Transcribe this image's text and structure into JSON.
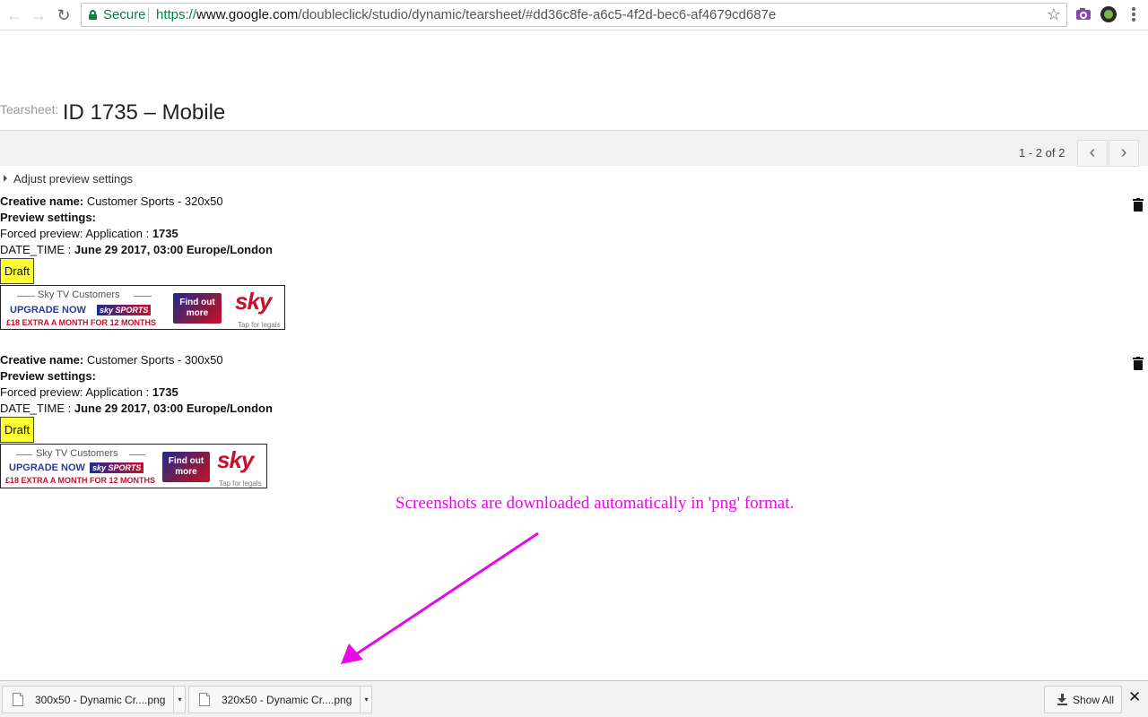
{
  "browser": {
    "secure_label": "Secure",
    "url_scheme": "https://",
    "url_host": "www.google.com",
    "url_path": "/doubleclick/studio/dynamic/tearsheet/#dd36c8fe-a6c5-4f2d-bec6-af4679cd687e",
    "back_icon": "←",
    "forward_icon": "→",
    "reload_icon": "↻",
    "star_icon": "☆"
  },
  "page": {
    "title_prefix": "Tearsheet:",
    "title": "ID 1735 – Mobile"
  },
  "pager": {
    "label": "1 - 2 of 2",
    "prev_icon": "‹",
    "next_icon": "›"
  },
  "adjust_settings_label": "Adjust preview settings",
  "creatives": [
    {
      "name_label": "Creative name:",
      "name_value": "Customer Sports - 320x50",
      "preview_settings_label": "Preview settings:",
      "forced_label": "Forced preview: Application :",
      "forced_value": "1735",
      "datetime_label": "DATE_TIME :",
      "datetime_value": "June 29 2017, 03:00 Europe/London",
      "status": "Draft",
      "ad": {
        "headline": "Sky TV Customers",
        "upgrade": "UPGRADE NOW",
        "sports_tag": "sky SPORTS",
        "extra": "£18 EXTRA A MONTH FOR 12 MONTHS",
        "cta": "Find out more",
        "logo": "sky",
        "legals": "Tap for legals"
      }
    },
    {
      "name_label": "Creative name:",
      "name_value": "Customer Sports - 300x50",
      "preview_settings_label": "Preview settings:",
      "forced_label": "Forced preview: Application :",
      "forced_value": "1735",
      "datetime_label": "DATE_TIME :",
      "datetime_value": "June 29 2017, 03:00 Europe/London",
      "status": "Draft",
      "ad": {
        "headline": "Sky TV Customers",
        "upgrade": "UPGRADE NOW",
        "sports_tag": "sky SPORTS",
        "extra": "£18 EXTRA A MONTH FOR 12 MONTHS",
        "cta": "Find out more",
        "logo": "sky",
        "legals": "Tap for legals"
      }
    }
  ],
  "annotation": {
    "text": "Screenshots are downloaded automatically in 'png' format.",
    "color": "#e60ae6"
  },
  "downloads": {
    "items": [
      {
        "label": "300x50 - Dynamic Cr....png"
      },
      {
        "label": "320x50 - Dynamic Cr....png"
      }
    ],
    "show_all_label": "Show All",
    "close_icon": "✕",
    "caret_icon": "▾"
  },
  "colors": {
    "secure_green": "#0b8043",
    "draft_yellow": "#ffff33",
    "sky_red": "#c8102e",
    "sky_blue": "#1d2b8f"
  }
}
